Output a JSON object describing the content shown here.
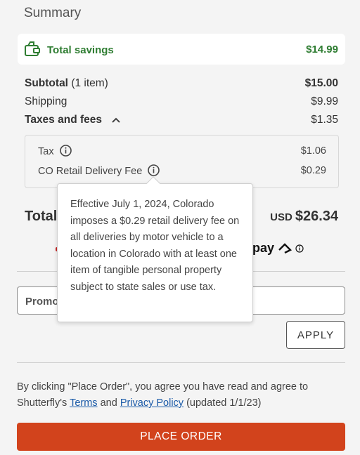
{
  "summary": {
    "title": "Summary",
    "savings_label": "Total savings",
    "savings_value": "$14.99",
    "subtotal_label": "Subtotal",
    "subtotal_count": "(1 item)",
    "subtotal_value": "$15.00",
    "shipping_label": "Shipping",
    "shipping_value": "$9.99",
    "taxes_label": "Taxes and fees",
    "taxes_value": "$1.35",
    "tax_label": "Tax",
    "tax_value": "$1.06",
    "co_fee_label": "CO Retail Delivery Fee",
    "co_fee_value": "$0.29",
    "total_label": "Total",
    "total_currency": "USD",
    "total_value": "$26.34"
  },
  "afterpay": {
    "text": "rpay"
  },
  "tooltip": {
    "text": "Effective July 1, 2024, Colorado imposes a $0.29 retail delivery fee on all deliveries by motor vehicle to a location in Colorado with at least one item of tangible personal property subject to state sales or use tax."
  },
  "promo": {
    "placeholder": "Promo",
    "apply_label": "APPLY"
  },
  "legal": {
    "prefix": "By clicking \"Place Order\", you agree you have read and agree to Shutterfly's",
    "terms": "Terms",
    "and": "and",
    "privacy": "Privacy Policy",
    "suffix": "(updated 1/1/23)"
  },
  "place_order": {
    "label": "PLACE ORDER"
  },
  "colors": {
    "savings_green": "#2f7d32",
    "place_order_bg": "#d2431c",
    "link_blue": "#1a5aa8"
  },
  "icons": {
    "savings": "wallet-tag-icon",
    "info": "info-circle-icon",
    "chevron": "chevron-up-icon",
    "afterpay": "afterpay-logo-icon"
  }
}
